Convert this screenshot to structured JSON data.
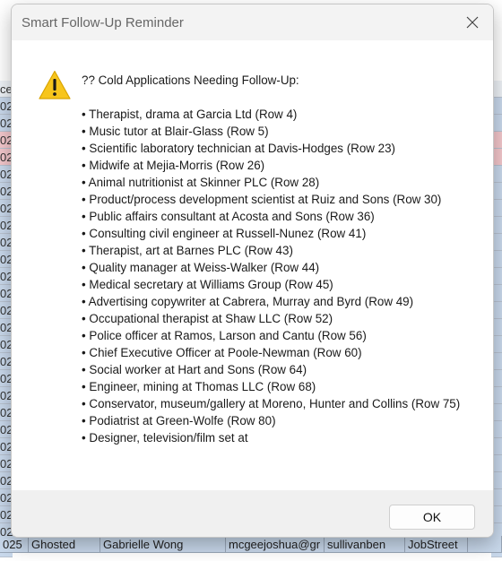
{
  "dialog": {
    "title": "Smart Follow-Up Reminder",
    "close_glyph": "✕",
    "icon": "warning-icon",
    "heading": "?? Cold Applications Needing Follow-Up:",
    "items": [
      "• Therapist, drama at Garcia Ltd (Row 4)",
      "• Music tutor at Blair-Glass (Row 5)",
      "• Scientific laboratory technician at Davis-Hodges (Row 23)",
      "• Midwife at Mejia-Morris (Row 26)",
      "• Animal nutritionist at Skinner PLC (Row 28)",
      "• Product/process development scientist at Ruiz and Sons (Row 30)",
      "• Public affairs consultant at Acosta and Sons (Row 36)",
      "• Consulting civil engineer at Russell-Nunez (Row 41)",
      "• Therapist, art at Barnes PLC (Row 43)",
      "• Quality manager at Weiss-Walker (Row 44)",
      "• Medical secretary at Williams Group (Row 45)",
      "• Advertising copywriter at Cabrera, Murray and Byrd (Row 49)",
      "• Occupational therapist at Shaw LLC (Row 52)",
      "• Police officer at Ramos, Larson and Cantu (Row 56)",
      "• Chief Executive Officer at Poole-Newman (Row 60)",
      "• Social worker at Hart and Sons (Row 64)",
      "• Engineer, mining at Thomas LLC (Row 68)",
      "• Conservator, museum/gallery at Moreno, Hunter and Collins (Row 75)",
      "• Podiatrist at Green-Wolfe (Row 80)",
      "• Designer, television/film set at"
    ],
    "ok_label": "OK"
  },
  "background": {
    "left_cells": [
      "ce",
      "02",
      "02",
      "02",
      "02",
      "02",
      "02",
      "02",
      "02",
      "02",
      "02",
      "02",
      "02",
      "02",
      "02",
      "02",
      "02",
      "02",
      "02",
      "02",
      "02",
      "02",
      "02",
      "02",
      "02",
      "02",
      "02",
      "02"
    ],
    "bottom_row": [
      "025",
      "Ghosted",
      "Gabrielle Wong",
      "mcgeejoshua@gr",
      "sullivanben",
      "JobStreet",
      ""
    ],
    "colors": {
      "row_blue": "#c9d9ec",
      "row_pink": "#f4c7cc",
      "row_white": "#eef2f7",
      "accent_warning": "#f5c518"
    }
  }
}
